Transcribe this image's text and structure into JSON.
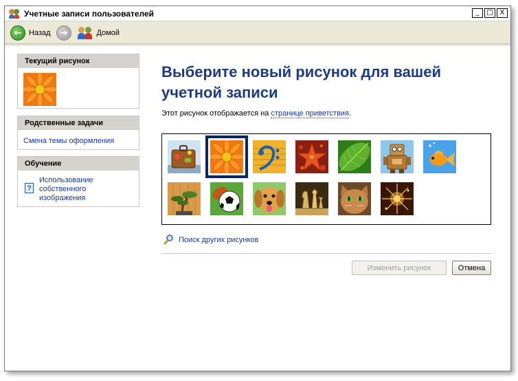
{
  "window": {
    "title": "Учетные записи пользователей",
    "buttons": {
      "minimize": "_",
      "maximize": "□",
      "close": "X"
    }
  },
  "toolbar": {
    "back_label": "Назад",
    "back_glyph": "←",
    "forward_glyph": "→",
    "home_label": "Домой"
  },
  "sidebar": {
    "current_picture": {
      "title": "Текущий рисунок",
      "picture_icon": "orange-flower-icon"
    },
    "related_tasks": {
      "title": "Родственные задачи",
      "links": [
        "Смена темы оформления"
      ]
    },
    "learning": {
      "title": "Обучение",
      "help_glyph": "?",
      "links": [
        "Использование собственного изображения"
      ]
    }
  },
  "main": {
    "title": "Выберите новый рисунок для вашей учетной записи",
    "description_prefix": "Этот рисунок отображается на ",
    "description_link": "странице приветствия",
    "description_suffix": ".",
    "pictures": [
      {
        "icon": "suitcase-icon",
        "selected": false
      },
      {
        "icon": "orange-flower-icon",
        "selected": true
      },
      {
        "icon": "bass-clef-icon",
        "selected": false
      },
      {
        "icon": "starfish-icon",
        "selected": false
      },
      {
        "icon": "green-leaf-icon",
        "selected": false
      },
      {
        "icon": "robot-icon",
        "selected": false
      },
      {
        "icon": "goldfish-icon",
        "selected": false
      },
      {
        "icon": "bonsai-tree-icon",
        "selected": false
      },
      {
        "icon": "soccer-ball-icon",
        "selected": false
      },
      {
        "icon": "dog-icon",
        "selected": false
      },
      {
        "icon": "chess-pieces-icon",
        "selected": false
      },
      {
        "icon": "kitten-icon",
        "selected": false
      },
      {
        "icon": "sparkles-icon",
        "selected": false
      }
    ],
    "search_link": "Поиск других рисунков",
    "change_button": "Изменить рисунок",
    "cancel_button": "Отмена"
  },
  "colors": {
    "title_blue": "#1b3b82",
    "link_blue": "#1638a0",
    "panel_header": "#d6d3ce",
    "selection_border": "#0a246a"
  }
}
